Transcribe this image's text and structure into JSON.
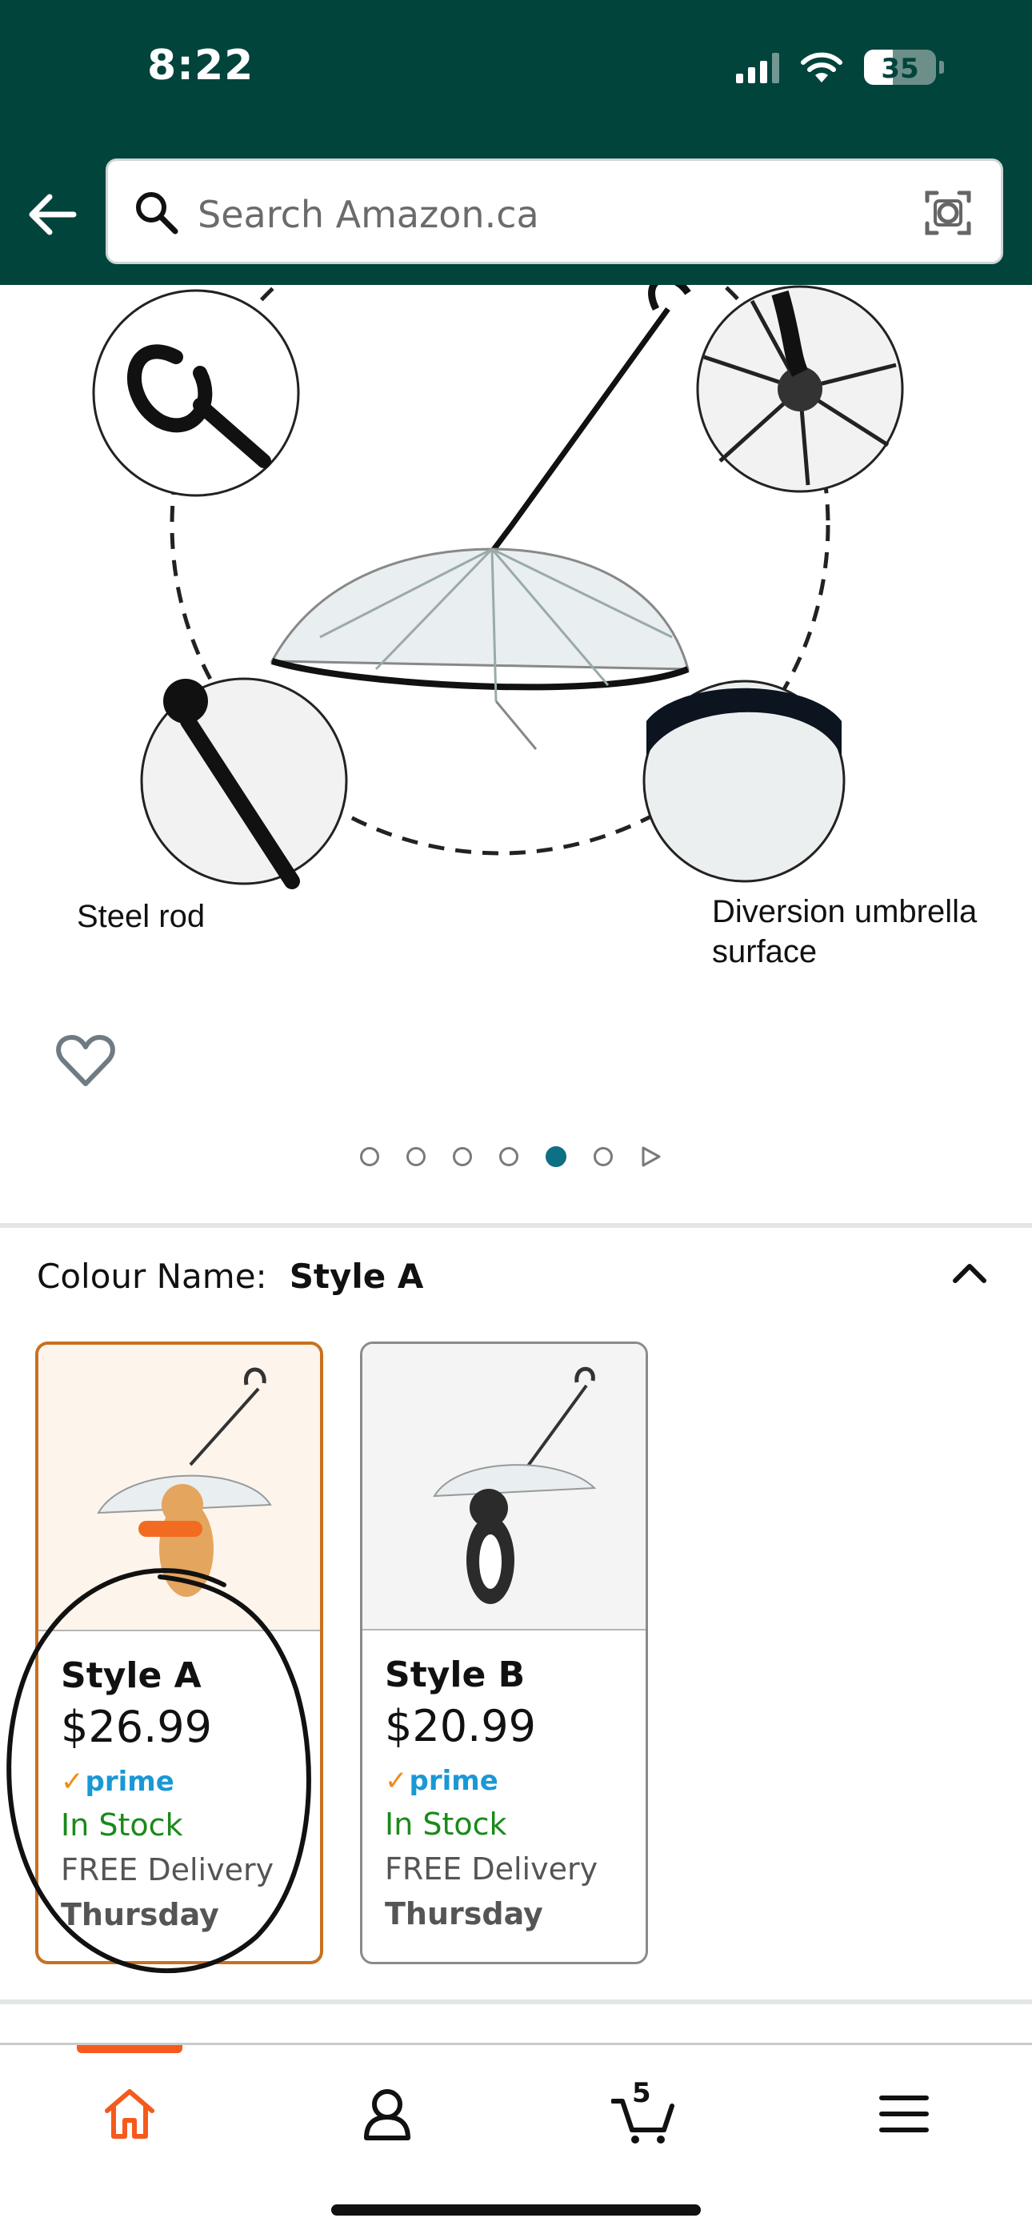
{
  "status_bar": {
    "time": "8:22",
    "battery": "35"
  },
  "header": {
    "search_placeholder": "Search Amazon.ca"
  },
  "product_image": {
    "captions": {
      "left": "Steel rod",
      "right_line1": "Diversion umbrella",
      "right_line2": "surface"
    },
    "carousel": {
      "total": 6,
      "active_index": 4
    }
  },
  "variation": {
    "label": "Colour Name:",
    "selected": "Style A",
    "options": [
      {
        "name": "Style A",
        "price": "$26.99",
        "prime": "prime",
        "stock": "In Stock",
        "delivery": "FREE Delivery",
        "day": "Thursday",
        "selected": true
      },
      {
        "name": "Style B",
        "price": "$20.99",
        "prime": "prime",
        "stock": "In Stock",
        "delivery": "FREE Delivery",
        "day": "Thursday",
        "selected": false
      }
    ]
  },
  "bottom_nav": {
    "items": [
      "home-icon",
      "account-icon",
      "cart-icon",
      "menu-icon"
    ],
    "cart_count": "5",
    "active": "home-icon"
  },
  "colors": {
    "header_bg": "#00443c",
    "accent_orange": "#f55a1c",
    "prime_blue": "#1a98d6",
    "in_stock_green": "#1a8a1a",
    "selected_border": "#c8701f",
    "active_dot": "#0f6f83"
  }
}
